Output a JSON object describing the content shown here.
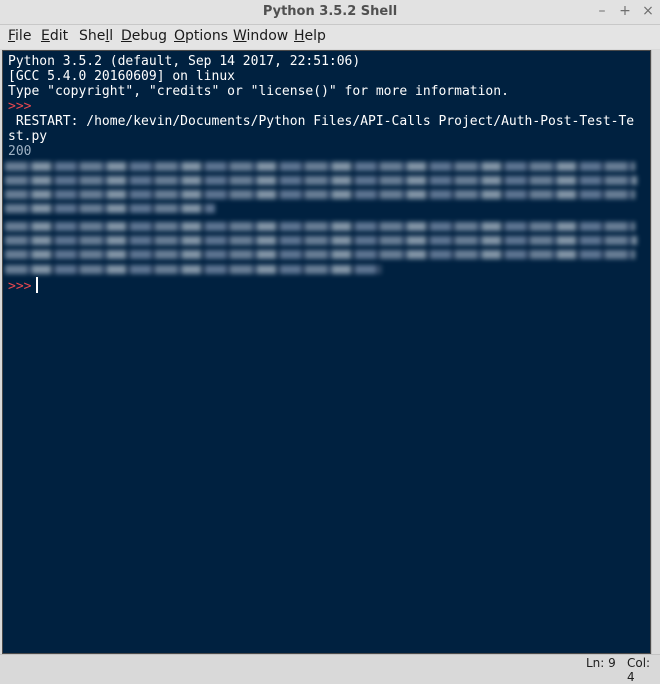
{
  "window": {
    "title": "Python 3.5.2 Shell",
    "controls": [
      "minimize-icon",
      "maximize-icon",
      "close-icon"
    ]
  },
  "menu": {
    "items": [
      {
        "pre": "",
        "mn": "F",
        "post": "ile"
      },
      {
        "pre": "",
        "mn": "E",
        "post": "dit"
      },
      {
        "pre": "She",
        "mn": "l",
        "post": "l"
      },
      {
        "pre": "",
        "mn": "D",
        "post": "ebug"
      },
      {
        "pre": "",
        "mn": "O",
        "post": "ptions"
      },
      {
        "pre": "",
        "mn": "W",
        "post": "indow"
      },
      {
        "pre": "",
        "mn": "H",
        "post": "elp"
      }
    ]
  },
  "shell": {
    "banner1": "Python 3.5.2 (default, Sep 14 2017, 22:51:06)",
    "banner2": "[GCC 5.4.0 20160609] on linux",
    "banner3": "Type \"copyright\", \"credits\" or \"license()\" for more information.",
    "prompt": ">>>",
    "restart1": " RESTART: /home/kevin/Documents/Python Files/API-Calls Project/Auth-Post-Test-Te",
    "restart2": "st.py",
    "output": "200",
    "current_prompt": ">>>"
  },
  "status": {
    "line": "Ln: 9",
    "col": "Col: 4"
  },
  "colors": {
    "editor_bg": "#002140",
    "prompt": "#e8484f",
    "stdout": "#9fb2c4"
  }
}
